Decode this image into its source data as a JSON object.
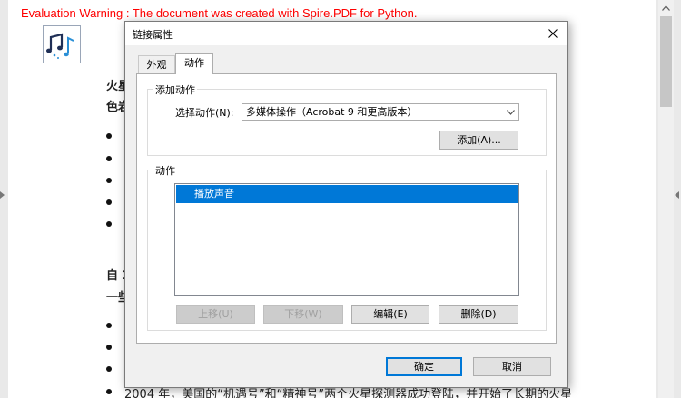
{
  "document": {
    "watermark": "Evaluation Warning : The document was created with Spire.PDF for Python.",
    "lines": [
      "火星",
      "色岩",
      "自 1",
      "一些"
    ],
    "bottom_line": "2004 年，美国的“机遇号”和“精神号”两个火星探测器成功登陆，并开始了长期的火星"
  },
  "colors": {
    "watermark": "#ff0000",
    "selection": "#0078d7",
    "dialog_bg": "#f0f0f0"
  },
  "dialog": {
    "title": "链接属性",
    "tabs": [
      {
        "label": "外观",
        "selected": false
      },
      {
        "label": "动作",
        "selected": true
      }
    ],
    "add_action_group": {
      "legend": "添加动作",
      "select_label": "选择动作(N):",
      "select_value": "多媒体操作（Acrobat 9 和更高版本）",
      "add_button": "添加(A)..."
    },
    "actions_group": {
      "legend": "动作",
      "items": [
        "播放声音"
      ],
      "buttons": {
        "up": "上移(U)",
        "down": "下移(W)",
        "edit": "编辑(E)",
        "delete": "删除(D)"
      }
    },
    "ok": "确定",
    "cancel": "取消"
  },
  "icons": {
    "logo": "music-notes-icon",
    "close": "close-icon",
    "dropdown": "chevron-down-icon",
    "scroll_up": "chevron-up-icon"
  }
}
